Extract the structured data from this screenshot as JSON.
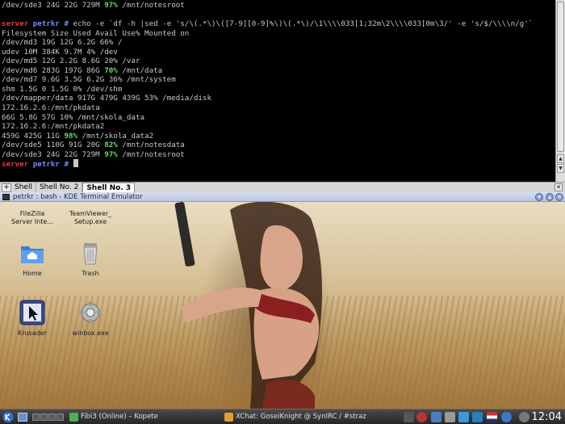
{
  "terminal": {
    "lines": [
      {
        "pre": "/dev/sde3 24G 22G 729M ",
        "hl": "97%",
        "post": " /mnt/notesroot"
      },
      {
        "pre": "",
        "hl": "",
        "post": ""
      },
      {
        "pre": "",
        "hl": "",
        "post": ""
      },
      {
        "pre": "Filesystem Size Used Avail Use% Mounted on",
        "hl": "",
        "post": ""
      },
      {
        "pre": "/dev/md3 19G 12G 6.2G 66% /",
        "hl": "",
        "post": ""
      },
      {
        "pre": "udev 10M 384K 9.7M 4% /dev",
        "hl": "",
        "post": ""
      },
      {
        "pre": "/dev/md5 12G 2.2G 8.6G 20% /var",
        "hl": "",
        "post": ""
      },
      {
        "pre": "/dev/md6 283G 197G 86G ",
        "hl": "70%",
        "post": " /mnt/data"
      },
      {
        "pre": "/dev/md7 9.6G 3.5G 6.2G 36% /mnt/system",
        "hl": "",
        "post": ""
      },
      {
        "pre": "shm 1.5G 0 1.5G 0% /dev/shm",
        "hl": "",
        "post": ""
      },
      {
        "pre": "/dev/mapper/data 917G 479G 439G 53% /media/disk",
        "hl": "",
        "post": ""
      },
      {
        "pre": "172.16.2.6:/mnt/pkdata",
        "hl": "",
        "post": ""
      },
      {
        "pre": "66G 5.8G 57G 10% /mnt/skola_data",
        "hl": "",
        "post": ""
      },
      {
        "pre": "172.16.2.6:/mnt/pkdata2",
        "hl": "",
        "post": ""
      },
      {
        "pre": "459G 425G 11G ",
        "hl": "98%",
        "post": " /mnt/skola_data2"
      },
      {
        "pre": "/dev/sde5 110G 91G 20G ",
        "hl": "82%",
        "post": " /mnt/notesdata"
      },
      {
        "pre": "/dev/sde3 24G 22G 729M ",
        "hl": "97%",
        "post": " /mnt/notesroot"
      }
    ],
    "prompt_host": "server",
    "prompt_user": "petrkr",
    "prompt_symbol": "#",
    "command": "echo -e `df -h |sed -e 's/\\(.*\\)\\([7-9][0-9]%\\)\\(.*\\)/\\1\\\\\\\\033[1;32m\\2\\\\\\\\033[0m\\3/' -e 's/$/\\\\\\\\n/g'`"
  },
  "tabs": {
    "items": [
      "Shell",
      "Shell No. 2",
      "Shell No. 3"
    ],
    "active": 2
  },
  "window": {
    "title": "petrkr : bash - KDE Terminal Emulator"
  },
  "desktop": {
    "icons": [
      {
        "label1": "FileZilla",
        "label2": "Server Inte...",
        "icon": "filezilla-icon"
      },
      {
        "label1": "TeamViewer_",
        "label2": "Setup.exe",
        "icon": "teamviewer-icon"
      },
      {
        "label1": "Home",
        "label2": "",
        "icon": "home-folder-icon"
      },
      {
        "label1": "Trash",
        "label2": "",
        "icon": "trash-icon"
      },
      {
        "label1": "Krusader",
        "label2": "",
        "icon": "krusader-icon"
      },
      {
        "label1": "winbox.exe",
        "label2": "",
        "icon": "winbox-icon"
      }
    ]
  },
  "taskbar": {
    "tasks": [
      {
        "label": "Fibi3 (Online) – Kopete",
        "icon": "kopete-icon",
        "color": "#4caf50"
      },
      {
        "label": "XChat: GoseiKnight @ SynIRC / #straz",
        "icon": "xchat-icon",
        "color": "#e0a030"
      }
    ],
    "clock": "12:04"
  },
  "colors": {
    "terminal_bg": "#000000",
    "highlight_green": "#5fe35f",
    "prompt_host": "#e23a3a",
    "prompt_user": "#6c8cff"
  }
}
